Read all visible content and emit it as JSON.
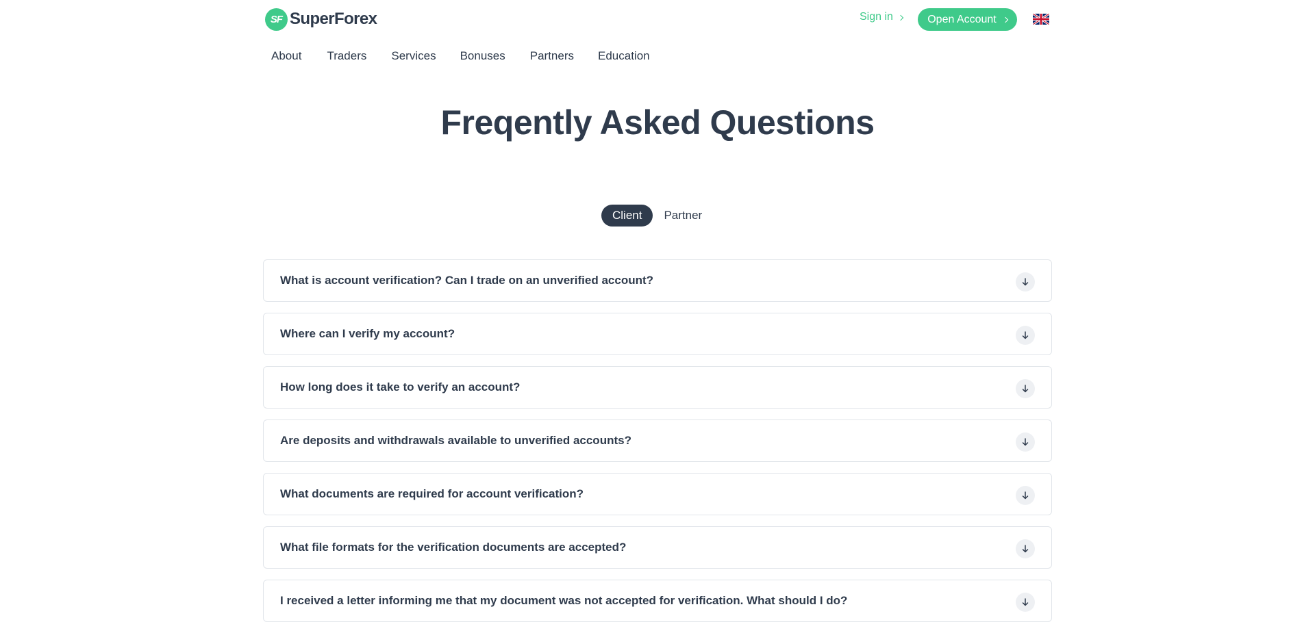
{
  "brand": {
    "logo_mark": "SF",
    "name": "SuperForex",
    "accent_color": "#3fca8a",
    "dark_color": "#2f3b4c"
  },
  "header": {
    "signin_label": "Sign in",
    "open_account_label": "Open Account",
    "language_icon": "uk-flag-icon"
  },
  "nav": {
    "items": [
      {
        "label": "About"
      },
      {
        "label": "Traders"
      },
      {
        "label": "Services"
      },
      {
        "label": "Bonuses"
      },
      {
        "label": "Partners"
      },
      {
        "label": "Education"
      }
    ]
  },
  "page_title": "Freqently Asked Questions",
  "tabs": [
    {
      "label": "Client",
      "active": true
    },
    {
      "label": "Partner",
      "active": false
    }
  ],
  "faq": {
    "toggle_icon": "arrow-down-icon",
    "items": [
      {
        "question": "What is account verification? Can I trade on an unverified account?"
      },
      {
        "question": "Where can I verify my account?"
      },
      {
        "question": "How long does it take to verify an account?"
      },
      {
        "question": "Are deposits and withdrawals available to unverified accounts?"
      },
      {
        "question": "What documents are required for account verification?"
      },
      {
        "question": "What file formats for the verification documents are accepted?"
      },
      {
        "question": "I received a letter informing me that my document was not accepted for verification. What should I do?"
      }
    ]
  }
}
